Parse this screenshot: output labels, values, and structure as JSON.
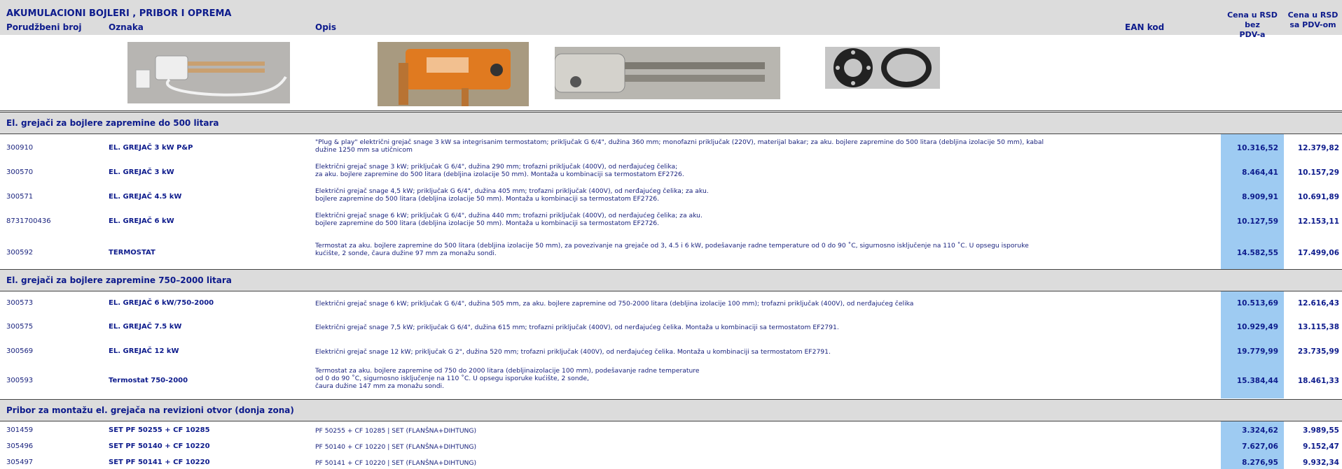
{
  "header": {
    "title": "AKUMULACIONI BOJLERI , PRIBOR I OPREMA",
    "col_order": "Porudžbeni broj",
    "col_label": "Oznaka",
    "col_desc": "Opis",
    "col_ean": "EAN kod",
    "col_price_net_1": "Cena u RSD bez",
    "col_price_net_2": "PDV-a",
    "col_price_gross_1": "Cena u RSD",
    "col_price_gross_2": "sa PDV-om"
  },
  "images": [
    "heater-plug-play-image",
    "thermostat-image",
    "heating-rod-image",
    "gasket-set-image"
  ],
  "sections": [
    {
      "title": "El. grejači za bojlere zapremine do 500 litara",
      "rows": [
        {
          "code": "300910",
          "name": "EL. GREJAČ 3 kW P&P",
          "desc": "\"Plug & play\" električni grejač snage 3 kW sa integrisanim termostatom; priključak G 6/4\", dužina 360 mm; monofazni priključak (220V), materijal bakar; za aku. bojlere zapremine do 500 litara (debljina izolacije 50 mm), kabal\ndužine 1250 mm sa utičnicom",
          "net": "10.316,52",
          "gross": "12.379,82"
        },
        {
          "code": "300570",
          "name": "EL. GREJAČ 3 kW",
          "desc": "Električni grejač snage 3 kW; priključak G 6/4\", dužina 290 mm; trofazni priključak (400V), od nerđajućeg čelika;\n za aku. bojlere zapremine do 500 litara (debljina izolacije 50 mm). Montaža u kombinaciji sa termostatom EF2726.",
          "net": "8.464,41",
          "gross": "10.157,29"
        },
        {
          "code": "300571",
          "name": "EL. GREJAČ 4.5 kW",
          "desc": "Električni grejač snage 4,5 kW; priključak G 6/4\", dužina 405 mm; trofazni priključak (400V), od nerđajućeg čelika; za aku.\nbojlere zapremine do 500 litara (debljina izolacije 50 mm). Montaža u kombinaciji sa termostatom EF2726.",
          "net": "8.909,91",
          "gross": "10.691,89"
        },
        {
          "code": "8731700436",
          "name": "EL. GREJAČ 6 kW",
          "desc": "Električni grejač snage 6 kW; priključak G 6/4\", dužina 440 mm; trofazni priključak (400V), od nerđajućeg čelika; za aku.\n bojlere zapremine do 500 litara (debljina izolacije 50 mm). Montaža u kombinaciji sa termostatom EF2726.",
          "net": "10.127,59",
          "gross": "12.153,11"
        },
        {
          "code": "300592",
          "name": "TERMOSTAT",
          "desc": "Termostat za aku. bojlere zapremine do 500 litara (debljina izolacije 50 mm), za povezivanje na grejače od 3, 4.5 i 6 kW, podešavanje radne temperature od 0 do 90 ˚C, sigurnosno isključenje na 110 ˚C. U opsegu isporuke\nkućište, 2 sonde, čaura dužine 97 mm za monažu sondi.",
          "net": "14.582,55",
          "gross": "17.499,06"
        }
      ]
    },
    {
      "title": "El. grejači za bojlere zapremine 750–2000 litara",
      "rows": [
        {
          "code": "300573",
          "name": "EL. GREJAČ 6 kW/750-2000",
          "desc": "Električni grejač snage 6 kW; priključak G 6/4\", dužina 505 mm, za aku. bojlere zapremine od 750-2000 litara (debljina izolacije 100 mm); trofazni priključak (400V), od nerđajućeg čelika",
          "net": "10.513,69",
          "gross": "12.616,43"
        },
        {
          "code": "300575",
          "name": "EL. GREJAČ 7.5 kW",
          "desc": "Električni grejač snage 7,5 kW; priključak G 6/4\", dužina 615 mm; trofazni priključak (400V), od nerđajućeg čelika. Montaža u kombinaciji sa termostatom EF2791.",
          "net": "10.929,49",
          "gross": "13.115,38"
        },
        {
          "code": "300569",
          "name": "EL. GREJAČ 12 kW",
          "desc": "Električni grejač snage 12 kW; priključak G 2\", dužina 520 mm; trofazni priključak (400V), od nerđajućeg čelika. Montaža u kombinaciji sa termostatom EF2791.",
          "net": "19.779,99",
          "gross": "23.735,99"
        },
        {
          "code": "300593",
          "name": "Termostat 750-2000",
          "desc": "Termostat za aku. bojlere zapremine od 750 do 2000 litara (debljinaizolacije 100 mm), podešavanje radne temperature\n od 0 do 90 ˚C, sigurnosno isključenje na 110 ˚C. U opsegu isporuke kućište, 2 sonde,\n čaura dužine 147 mm za monažu sondi.",
          "net": "15.384,44",
          "gross": "18.461,33"
        }
      ]
    },
    {
      "title": "Pribor za montažu el. grejača na revizioni otvor (donja zona)",
      "rows": [
        {
          "code": "301459",
          "name": "SET PF 50255 + CF 10285",
          "desc": "PF 50255 + CF 10285 | SET (FLANŠNA+DIHTUNG)",
          "net": "3.324,62",
          "gross": "3.989,55"
        },
        {
          "code": "305496",
          "name": "SET PF 50140 + CF 10220",
          "desc": "PF 50140 + CF 10220 | SET (FLANŠNA+DIHTUNG)",
          "net": "7.627,06",
          "gross": "9.152,47"
        },
        {
          "code": "305497",
          "name": "SET PF 50141 + CF 10220",
          "desc": "PF 50141 + CF 10220 | SET (FLANŠNA+DIHTUNG)",
          "net": "8.276,95",
          "gross": "9.932,34"
        }
      ]
    }
  ]
}
